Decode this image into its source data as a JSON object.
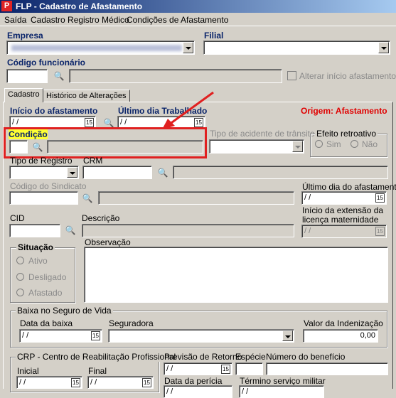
{
  "window": {
    "title": "FLP - Cadastro de Afastamento",
    "app_icon": "flp-logo-icon"
  },
  "menu": [
    "Saída",
    "Cadastro Registro Médico",
    "Condições de Afastamento"
  ],
  "empresa": {
    "label": "Empresa",
    "value": ""
  },
  "filial": {
    "label": "Filial",
    "value": ""
  },
  "codigo_funcionario": {
    "label": "Código funcionário",
    "value": "",
    "checkbox_label": "Alterar início afastamento"
  },
  "tabs": [
    "Cadastro",
    "Histórico de Alterações"
  ],
  "inicio_afastamento": {
    "label": "Início do afastamento",
    "value": " / /"
  },
  "ultimo_dia_trabalhado": {
    "label": "Último dia Trabalhado",
    "value": " / /"
  },
  "origem": "Origem: Afastamento",
  "condicao": {
    "label": "Condição"
  },
  "tipo_acidente": {
    "label": "Tipo de acidente de trânsito"
  },
  "efeito_retroativo": {
    "label": "Efeito retroativo",
    "sim": "Sim",
    "nao": "Não"
  },
  "tipo_registro": {
    "label": "Tipo de Registro"
  },
  "crm": {
    "label": "CRM"
  },
  "codigo_sindicato": {
    "label": "Código do Sindicato"
  },
  "ultimo_dia_afastamento": {
    "label": "Último dia do afastamento",
    "value": " / /"
  },
  "cid": {
    "label": "CID"
  },
  "descricao": {
    "label": "Descrição"
  },
  "inicio_extensao": {
    "label1": "Início da extensão da",
    "label2": "licença maternidade",
    "value": " / /"
  },
  "situacao": {
    "label": "Situação",
    "options": [
      "Ativo",
      "Desligado",
      "Afastado"
    ]
  },
  "observacao": {
    "label": "Observação"
  },
  "baixa_seguro": {
    "label": "Baixa no Seguro de Vida",
    "data_baixa_label": "Data da baixa",
    "data_baixa_value": " / /",
    "seguradora_label": "Seguradora",
    "valor_label": "Valor da Indenização",
    "valor_value": "0,00"
  },
  "crp": {
    "label": "CRP - Centro de Reabilitação Profissional",
    "inicial_label": "Inicial",
    "inicial_value": " / /",
    "final_label": "Final",
    "final_value": " / /"
  },
  "previsao_retorno": {
    "label": "Previsão de Retorno",
    "value": " / /"
  },
  "especie": {
    "label": "Espécie"
  },
  "numero_beneficio": {
    "label": "Número do benefício"
  },
  "data_pericia": {
    "label": "Data da perícia",
    "value": " / /"
  },
  "termino_servico_militar": {
    "label": "Término serviço militar",
    "value": " / /"
  },
  "cal_glyph": "15"
}
